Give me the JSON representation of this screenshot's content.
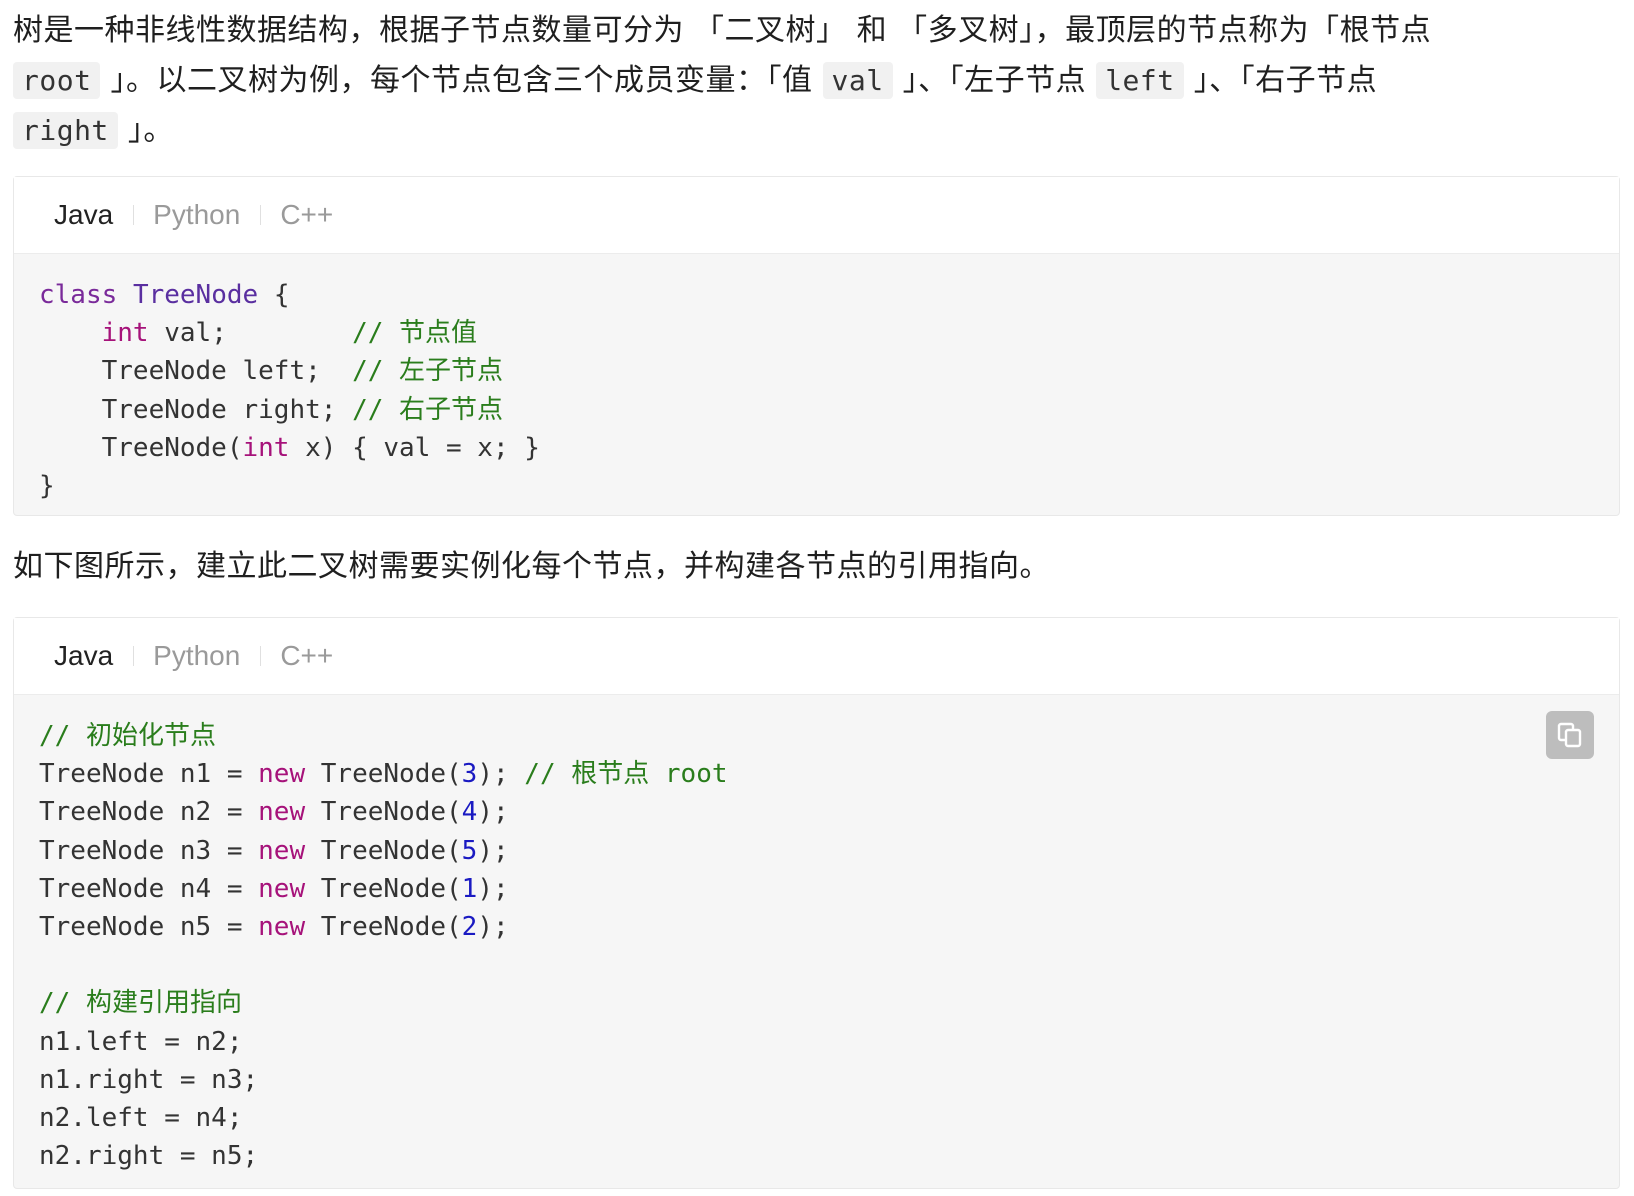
{
  "intro": {
    "t1": "树是一种非线性数据结构，根据子节点数量可分为 「二叉树」 和 「多叉树」，最顶层的节点称为「根节点",
    "root_code": "root",
    "t2": "」。以二叉树为例，每个节点包含三个成员变量：「值",
    "val_code": "val",
    "t3": "」、「左子节点",
    "left_code": "left",
    "t4": "」、「右子节点",
    "right_code": "right",
    "t5": "」。"
  },
  "para2": "如下图所示，建立此二叉树需要实例化每个节点，并构建各节点的引用指向。",
  "block1": {
    "tabs": [
      "Java",
      "Python",
      "C++"
    ],
    "code": {
      "l1_kw": "class",
      "l1_type": "TreeNode",
      "l1_rest": " {",
      "l2_indent": "    ",
      "l2_kw": "int",
      "l2_rest": " val;        ",
      "l2_cm": "// 节点值",
      "l3_rest": "    TreeNode left;  ",
      "l3_cm": "// 左子节点",
      "l4_rest": "    TreeNode right; ",
      "l4_cm": "// 右子节点",
      "l5_a": "    TreeNode(",
      "l5_kw": "int",
      "l5_b": " x) { val = x; }",
      "l6": "}"
    }
  },
  "block2": {
    "tabs": [
      "Java",
      "Python",
      "C++"
    ],
    "comment1": "// 初始化节点",
    "inits": [
      {
        "lhs": "TreeNode n1 = ",
        "kw": "new",
        "ctor": " TreeNode(",
        "num": "3",
        "end": ");",
        "cm": " // 根节点 root"
      },
      {
        "lhs": "TreeNode n2 = ",
        "kw": "new",
        "ctor": " TreeNode(",
        "num": "4",
        "end": ");",
        "cm": ""
      },
      {
        "lhs": "TreeNode n3 = ",
        "kw": "new",
        "ctor": " TreeNode(",
        "num": "5",
        "end": ");",
        "cm": ""
      },
      {
        "lhs": "TreeNode n4 = ",
        "kw": "new",
        "ctor": " TreeNode(",
        "num": "1",
        "end": ");",
        "cm": ""
      },
      {
        "lhs": "TreeNode n5 = ",
        "kw": "new",
        "ctor": " TreeNode(",
        "num": "2",
        "end": ");",
        "cm": ""
      }
    ],
    "comment2": "// 构建引用指向",
    "links": [
      "n1.left = n2;",
      "n1.right = n3;",
      "n2.left = n4;",
      "n2.right = n5;"
    ],
    "copy_icon": "copy-icon"
  }
}
